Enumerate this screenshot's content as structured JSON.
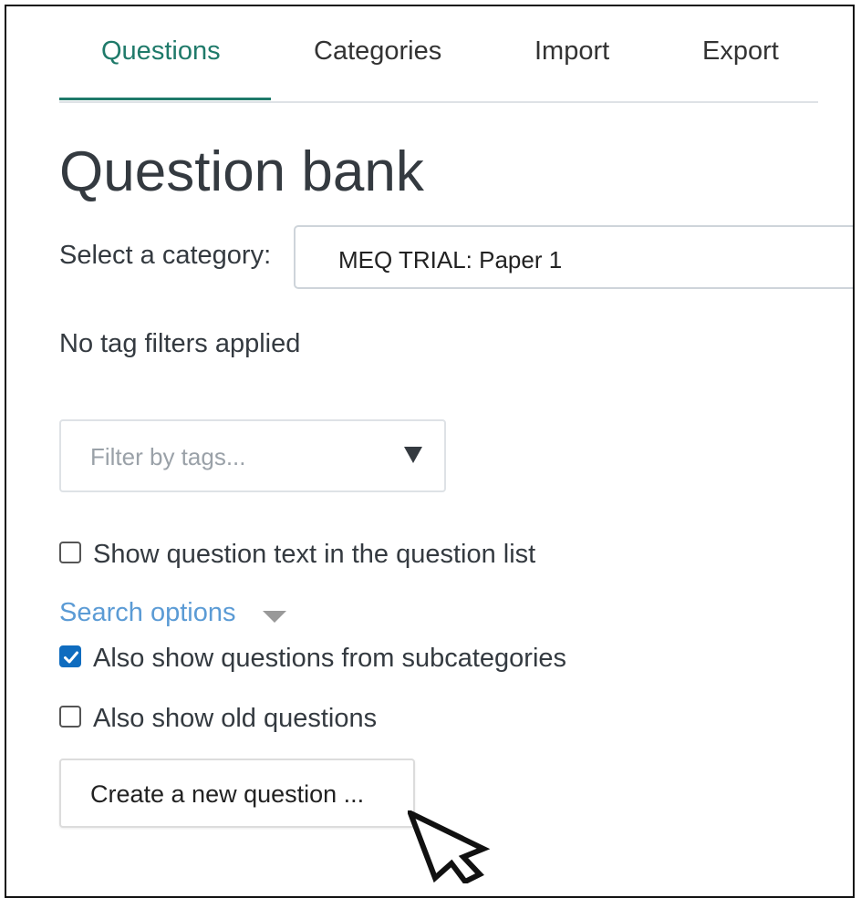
{
  "tabs": [
    {
      "label": "Questions",
      "active": true
    },
    {
      "label": "Categories",
      "active": false
    },
    {
      "label": "Import",
      "active": false
    },
    {
      "label": "Export",
      "active": false
    }
  ],
  "page": {
    "title": "Question bank"
  },
  "category": {
    "label": "Select a category:",
    "selected": "MEQ TRIAL: Paper 1"
  },
  "tags": {
    "status": "No tag filters applied",
    "placeholder": "Filter by tags..."
  },
  "options": {
    "show_text": {
      "label": "Show question text in the question list",
      "checked": false
    },
    "search_options_label": "Search options",
    "subcategories": {
      "label": "Also show questions from subcategories",
      "checked": true
    },
    "old_questions": {
      "label": "Also show old questions",
      "checked": false
    }
  },
  "actions": {
    "create_label": "Create a new question ..."
  },
  "colors": {
    "accent": "#1f7a6a",
    "link": "#5b9bd5",
    "checkbox_checked": "#0f6cbf"
  },
  "icons": {
    "tag_dropdown": "caret-down-icon",
    "search_toggle": "caret-down-icon",
    "pointer": "mouse-cursor-icon"
  }
}
